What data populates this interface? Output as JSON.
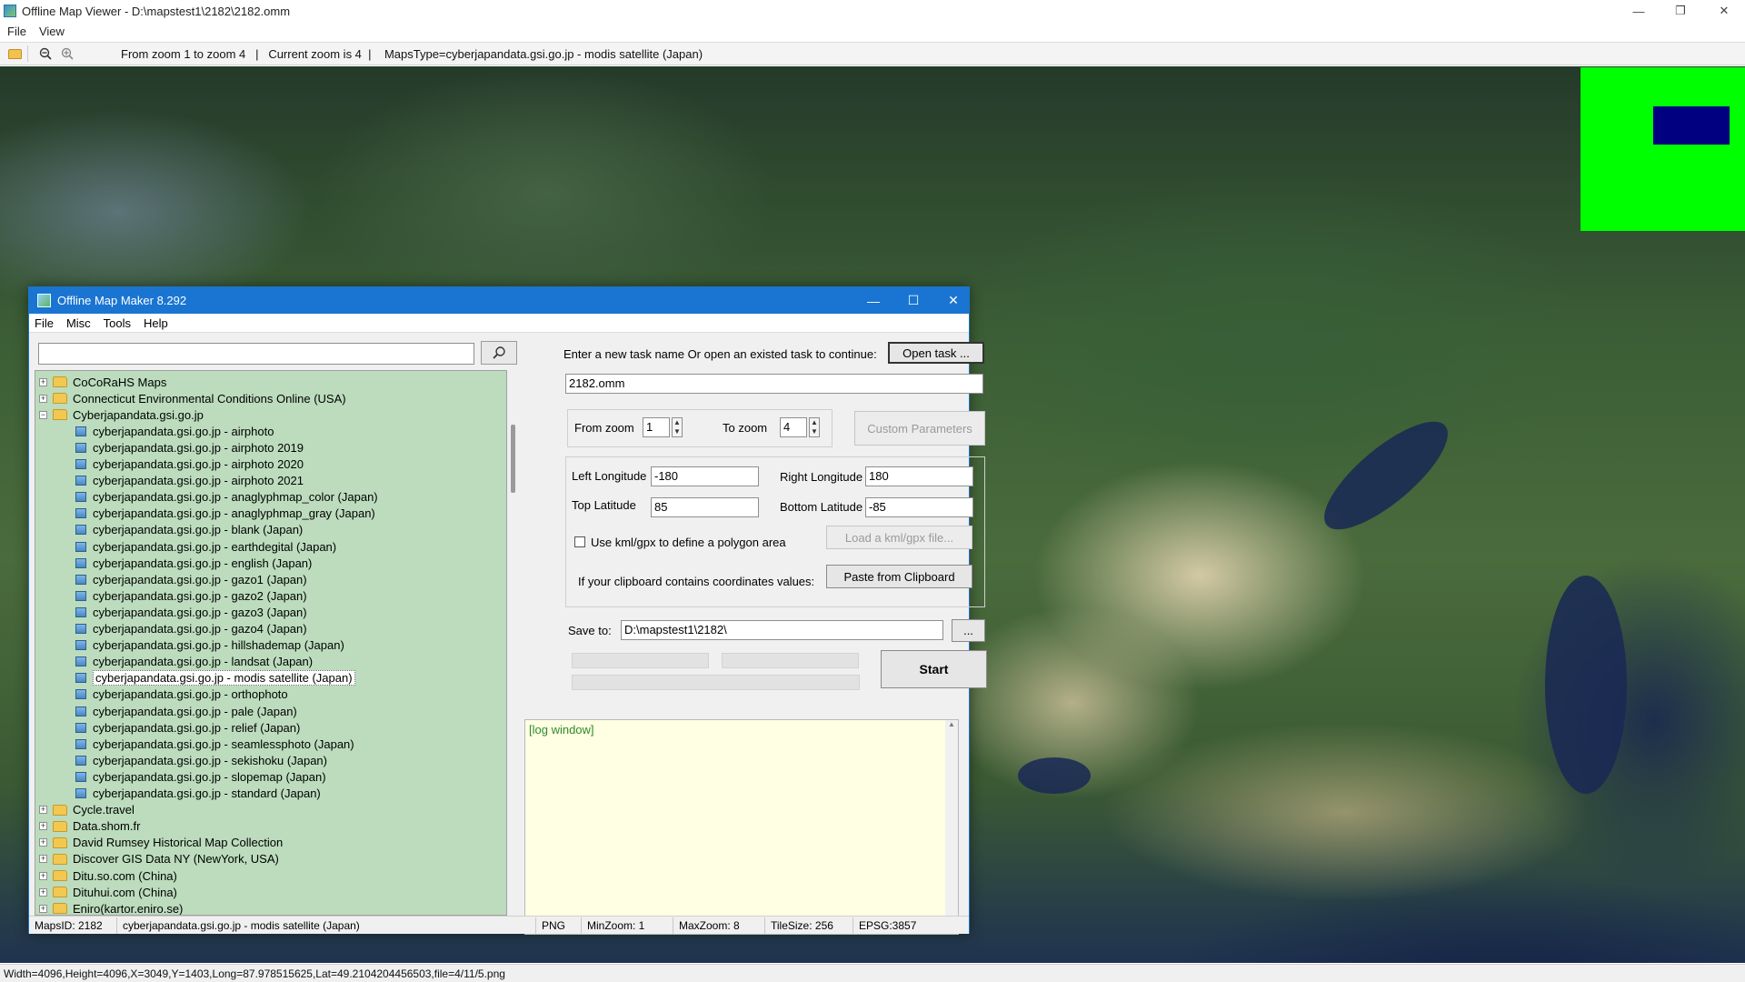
{
  "window": {
    "title": "Offline Map Viewer - D:\\mapstest1\\2182\\2182.omm",
    "min_label": "—",
    "max_label": "❐",
    "close_label": "✕"
  },
  "menu": [
    "File",
    "View"
  ],
  "toolbar": {
    "zoom_status": "From zoom 1 to zoom 4   |   Current zoom is 4  |    MapsType=cyberjapandata.gsi.go.jp - modis satellite (Japan)"
  },
  "status_bar": "Width=4096,Height=4096,X=3049,Y=1403,Long=87.978515625,Lat=49.2104204456503,file=4/11/5.png",
  "colors": {
    "overview_bg": "#00ff00",
    "overview_viewport": "#000080",
    "dialog_title_bg": "#1a75d2",
    "tree_bg": "#bcdcbd",
    "log_bg": "#ffffe3"
  },
  "dialog": {
    "title": "Offline Map Maker 8.292",
    "menu": [
      "File",
      "Misc",
      "Tools",
      "Help"
    ],
    "search_value": "",
    "tree": [
      {
        "label": "CoCoRaHS Maps",
        "kind": "folder",
        "expanded": false
      },
      {
        "label": "Connecticut Environmental Conditions Online (USA)",
        "kind": "folder",
        "expanded": false
      },
      {
        "label": "Cyberjapandata.gsi.go.jp",
        "kind": "folder",
        "expanded": true
      },
      {
        "label": "cyberjapandata.gsi.go.jp - airphoto",
        "kind": "map"
      },
      {
        "label": "cyberjapandata.gsi.go.jp - airphoto 2019",
        "kind": "map"
      },
      {
        "label": "cyberjapandata.gsi.go.jp - airphoto 2020",
        "kind": "map"
      },
      {
        "label": "cyberjapandata.gsi.go.jp - airphoto 2021",
        "kind": "map"
      },
      {
        "label": "cyberjapandata.gsi.go.jp - anaglyphmap_color (Japan)",
        "kind": "map"
      },
      {
        "label": "cyberjapandata.gsi.go.jp - anaglyphmap_gray (Japan)",
        "kind": "map"
      },
      {
        "label": "cyberjapandata.gsi.go.jp - blank (Japan)",
        "kind": "map"
      },
      {
        "label": "cyberjapandata.gsi.go.jp - earthdegital (Japan)",
        "kind": "map"
      },
      {
        "label": "cyberjapandata.gsi.go.jp - english (Japan)",
        "kind": "map"
      },
      {
        "label": "cyberjapandata.gsi.go.jp - gazo1 (Japan)",
        "kind": "map"
      },
      {
        "label": "cyberjapandata.gsi.go.jp - gazo2 (Japan)",
        "kind": "map"
      },
      {
        "label": "cyberjapandata.gsi.go.jp - gazo3 (Japan)",
        "kind": "map"
      },
      {
        "label": "cyberjapandata.gsi.go.jp - gazo4 (Japan)",
        "kind": "map"
      },
      {
        "label": "cyberjapandata.gsi.go.jp - hillshademap (Japan)",
        "kind": "map"
      },
      {
        "label": "cyberjapandata.gsi.go.jp - landsat (Japan)",
        "kind": "map"
      },
      {
        "label": "cyberjapandata.gsi.go.jp - modis satellite (Japan)",
        "kind": "map",
        "selected": true
      },
      {
        "label": "cyberjapandata.gsi.go.jp - orthophoto",
        "kind": "map"
      },
      {
        "label": "cyberjapandata.gsi.go.jp - pale (Japan)",
        "kind": "map"
      },
      {
        "label": "cyberjapandata.gsi.go.jp - relief (Japan)",
        "kind": "map"
      },
      {
        "label": "cyberjapandata.gsi.go.jp - seamlessphoto (Japan)",
        "kind": "map"
      },
      {
        "label": "cyberjapandata.gsi.go.jp - sekishoku (Japan)",
        "kind": "map"
      },
      {
        "label": "cyberjapandata.gsi.go.jp - slopemap (Japan)",
        "kind": "map"
      },
      {
        "label": "cyberjapandata.gsi.go.jp - standard (Japan)",
        "kind": "map"
      },
      {
        "label": "Cycle.travel",
        "kind": "folder",
        "expanded": false
      },
      {
        "label": "Data.shom.fr",
        "kind": "folder",
        "expanded": false
      },
      {
        "label": "David Rumsey Historical Map Collection",
        "kind": "folder",
        "expanded": false
      },
      {
        "label": "Discover GIS Data NY (NewYork, USA)",
        "kind": "folder",
        "expanded": false
      },
      {
        "label": "Ditu.so.com (China)",
        "kind": "folder",
        "expanded": false
      },
      {
        "label": "Dituhui.com (China)",
        "kind": "folder",
        "expanded": false
      },
      {
        "label": "Eniro(kartor.eniro.se)",
        "kind": "folder",
        "expanded": false
      }
    ],
    "task_prompt": "Enter a new task name Or open an existed task to continue:",
    "open_task_label": "Open task ...",
    "task_name": "2182.omm",
    "from_zoom_label": "From zoom",
    "from_zoom": "1",
    "to_zoom_label": "To zoom",
    "to_zoom": "4",
    "custom_params_label": "Custom Parameters",
    "left_lon_label": "Left Longitude",
    "left_lon": "-180",
    "right_lon_label": "Right Longitude",
    "right_lon": "180",
    "top_lat_label": "Top Latitude",
    "top_lat": "85",
    "bottom_lat_label": "Bottom Latitude",
    "bottom_lat": "-85",
    "kml_label": "Use kml/gpx to define a polygon area",
    "load_kml_label": "Load a kml/gpx file...",
    "clipboard_prompt": "If your clipboard contains coordinates values:",
    "paste_label": "Paste from Clipboard",
    "save_to_label": "Save to:",
    "save_to": "D:\\mapstest1\\2182\\",
    "browse_label": "...",
    "start_label": "Start",
    "log_text": "[log window]",
    "status": {
      "maps_id": "MapsID: 2182",
      "maps_name": "cyberjapandata.gsi.go.jp - modis satellite (Japan)",
      "format": "PNG",
      "min_zoom": "MinZoom: 1",
      "max_zoom": "MaxZoom: 8",
      "tile_size": "TileSize: 256",
      "epsg": "EPSG:3857"
    }
  }
}
